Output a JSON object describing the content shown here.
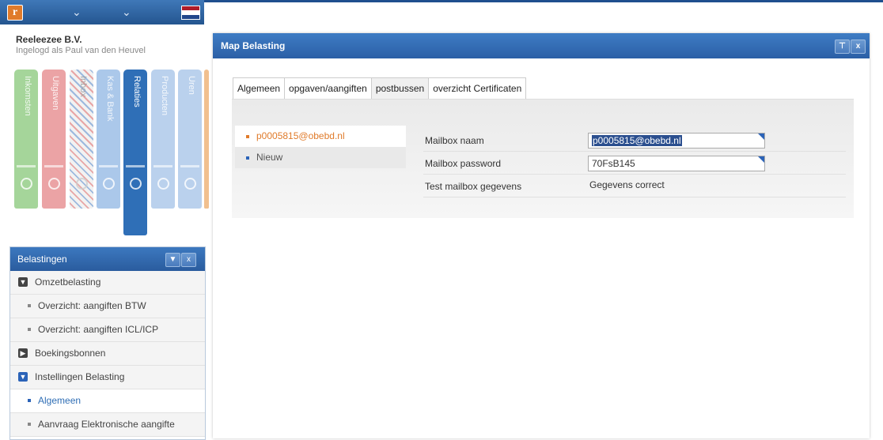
{
  "app": {
    "logo_letter": "r",
    "company": "Reeleezee B.V.",
    "user": "Ingelogd als Paul van den Heuvel"
  },
  "binders": [
    {
      "label": "Inkomsten",
      "color": "#9fcf93"
    },
    {
      "label": "Uitgaven",
      "color": "#e9a0a2"
    },
    {
      "label": "Inbox",
      "color": "#f4f4f4"
    },
    {
      "label": "Kas & Bank",
      "color": "#a9c6e8"
    },
    {
      "label": "Relaties",
      "color": "#2f6fb7"
    },
    {
      "label": "Producten",
      "color": "#b8d0ec"
    },
    {
      "label": "Uren",
      "color": "#b8d0ec"
    }
  ],
  "left_panel": {
    "title": "Belastingen",
    "items": [
      {
        "label": "Omzetbelasting",
        "type": "group",
        "toggle": "collapse"
      },
      {
        "label": "Overzicht: aangiften BTW",
        "type": "item"
      },
      {
        "label": "Overzicht: aangiften ICL/ICP",
        "type": "item"
      },
      {
        "label": "Boekingsbonnen",
        "type": "group",
        "toggle": "expand"
      },
      {
        "label": "Instellingen Belasting",
        "type": "group",
        "toggle": "collapse"
      },
      {
        "label": "Algemeen",
        "type": "item",
        "selected": true
      },
      {
        "label": "Aanvraag Elektronische aangifte",
        "type": "item"
      }
    ]
  },
  "window": {
    "title": "Map Belasting",
    "tabs": [
      "Algemeen",
      "opgaven/aangiften",
      "postbussen",
      "overzicht Certificaten"
    ],
    "active_tab": "postbussen",
    "mailboxes": [
      {
        "label": "p0005815@obebd.nl",
        "selected": true
      },
      {
        "label": "Nieuw"
      }
    ],
    "fields": [
      {
        "label": "Mailbox naam",
        "value": "p0005815@obebd.nl"
      },
      {
        "label": "Mailbox password",
        "value": "70FsB145"
      },
      {
        "label": "Test mailbox gegevens",
        "value": "Gegevens correct"
      }
    ]
  },
  "colors": {
    "accent": "#2b63b8",
    "selected_mail": "#e07b2b",
    "header": "#2b5fa6"
  }
}
